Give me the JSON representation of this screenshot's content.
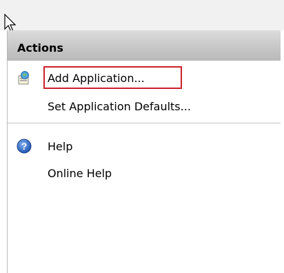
{
  "panel": {
    "title": "Actions",
    "items": [
      {
        "label": "Add Application...",
        "icon": "add-application-icon",
        "highlighted": true
      },
      {
        "label": "Set Application Defaults...",
        "icon": null
      },
      {
        "label": "Help",
        "icon": "help-icon"
      },
      {
        "label": "Online Help",
        "icon": null
      }
    ]
  },
  "colors": {
    "highlight_border": "#cc1f2a",
    "header_gradient_top": "#dcdcdc",
    "header_gradient_bottom": "#b9b9b9",
    "help_icon_blue": "#2a5fbf"
  }
}
